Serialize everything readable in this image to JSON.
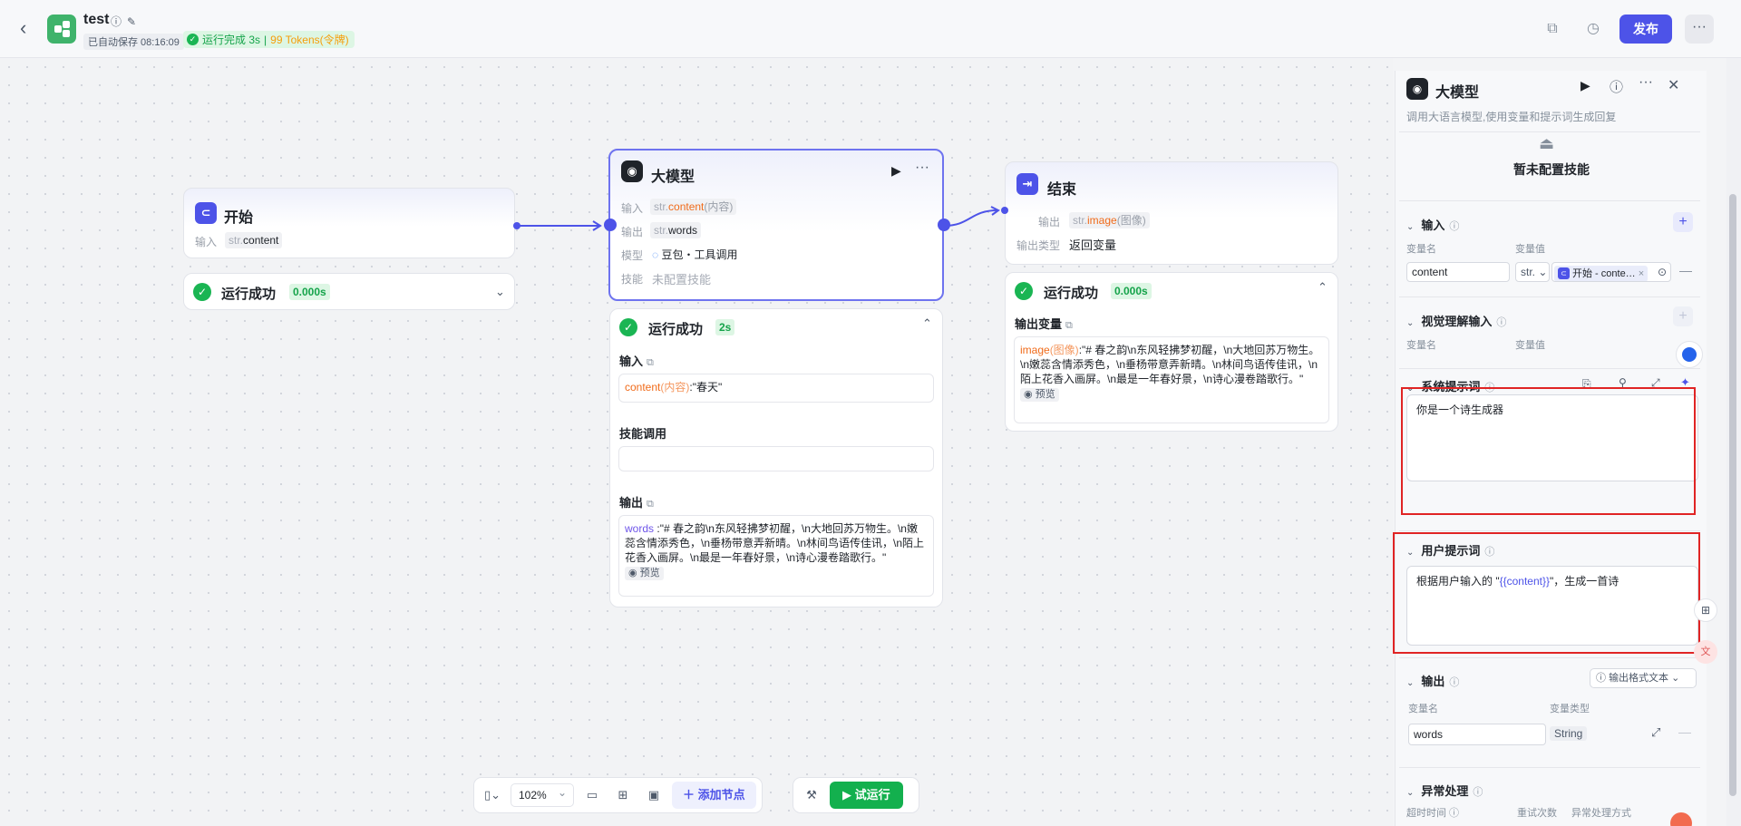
{
  "header": {
    "app_title": "test",
    "autosave": "已自动保存 08:16:09",
    "run_status": "运行完成 3s",
    "tokens": "99 Tokens(令牌)",
    "publish_label": "发布",
    "more_label": "···"
  },
  "nodes": {
    "start": {
      "title": "开始",
      "input_label": "输入",
      "input_type": "str.",
      "input_name": "content",
      "status": "运行成功",
      "time": "0.000s"
    },
    "llm": {
      "title": "大模型",
      "input_label": "输入",
      "input_type": "str.",
      "input_name": "content",
      "input_alias": "(内容)",
      "output_label": "输出",
      "output_type": "str.",
      "output_name": "words",
      "model_label": "模型",
      "model_value": "豆包・工具调用",
      "skill_label": "技能",
      "skill_value": "未配置技能",
      "status": "运行成功",
      "time": "2s",
      "input_section": "输入",
      "input_key": "content",
      "input_key_alias": "(内容)",
      "input_value": ":\"春天\"",
      "skill_section": "技能调用",
      "output_section": "输出",
      "output_key": "words",
      "output_value": ":\"# 春之韵\\n东风轻拂梦初醒，\\n大地回苏万物生。\\n嫩蕊含情添秀色，\\n垂杨带意弄新晴。\\n林间鸟语传佳讯，\\n陌上花香入画屏。\\n最是一年春好景，\\n诗心漫卷踏歌行。\"",
      "preview": "预览"
    },
    "end": {
      "title": "结束",
      "output_label": "输出",
      "output_type": "str.",
      "output_name": "image",
      "output_alias": "(图像)",
      "output_kind_label": "输出类型",
      "output_kind_value": "返回变量",
      "status": "运行成功",
      "time": "0.000s",
      "output_section": "输出变量",
      "output_key": "image",
      "output_key_alias": "(图像)",
      "output_value": ":\"# 春之韵\\n东风轻拂梦初醒，\\n大地回苏万物生。\\n嫩蕊含情添秀色，\\n垂杨带意弄新晴。\\n林间鸟语传佳讯，\\n陌上花香入画屏。\\n最是一年春好景，\\n诗心漫卷踏歌行。\"",
      "preview": "预览"
    }
  },
  "toolbar": {
    "zoom": "102%",
    "add_node": "添加节点",
    "trial_run": "试运行"
  },
  "panel": {
    "title": "大模型",
    "description": "调用大语言模型,使用变量和提示词生成回复",
    "skill_empty": "暂未配置技能",
    "input_section": "输入",
    "var_name_label": "变量名",
    "var_value_label": "变量值",
    "input_var_name": "content",
    "input_var_type": "str.",
    "input_ref_label": "开始 - conte…",
    "vision_section": "视觉理解输入",
    "vision_var_name_label": "变量名",
    "vision_var_value_label": "变量值",
    "system_prompt_section": "系统提示词",
    "system_prompt_text": "你是一个诗生成器",
    "user_prompt_section": "用户提示词",
    "user_prompt_prefix": "根据用户输入的 \"",
    "user_prompt_var": "{{content}}",
    "user_prompt_suffix": "\"，生成一首诗",
    "output_section": "输出",
    "output_format": "输出格式文本",
    "output_var_name_label": "变量名",
    "output_var_type_label": "变量类型",
    "output_var_name": "words",
    "output_var_type": "String",
    "error_section": "异常处理",
    "timeout_label": "超时时间",
    "retry_label": "重试次数",
    "error_mode_label": "异常处理方式"
  },
  "colors": {
    "accent": "#4d53e8",
    "success": "#1ab553",
    "highlight_box": "#e02424"
  }
}
